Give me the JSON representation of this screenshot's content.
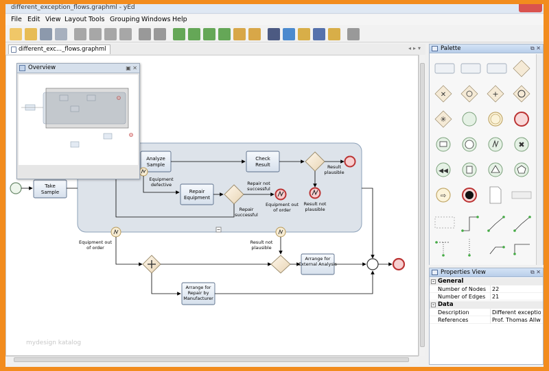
{
  "window": {
    "title": "different_exception_flows.graphml - yEd"
  },
  "menu": [
    "File",
    "Edit",
    "View",
    "Layout",
    "Tools",
    "Grouping",
    "Windows",
    "Help"
  ],
  "toolbar": [
    {
      "name": "new-document-icon",
      "color": "#f0c050"
    },
    {
      "name": "open-folder-icon",
      "color": "#e5b33a"
    },
    {
      "name": "save-icon",
      "color": "#7a8aa0"
    },
    {
      "name": "export-icon",
      "color": "#9aa5b5"
    },
    {
      "name": "cut-icon",
      "color": "#9a9a9a"
    },
    {
      "name": "copy-icon",
      "color": "#9a9a9a"
    },
    {
      "name": "paste-icon",
      "color": "#9a9a9a"
    },
    {
      "name": "delete-icon",
      "color": "#9a9a9a"
    },
    {
      "name": "undo-icon",
      "color": "#8a8a8a"
    },
    {
      "name": "redo-icon",
      "color": "#8a8a8a"
    },
    {
      "name": "zoom-in-icon",
      "color": "#4c9a3c"
    },
    {
      "name": "zoom-out-icon",
      "color": "#4c9a3c"
    },
    {
      "name": "zoom-original-icon",
      "color": "#4c9a3c"
    },
    {
      "name": "zoom-selection-icon",
      "color": "#4c9a3c"
    },
    {
      "name": "zoom-area-icon",
      "color": "#d39a2a"
    },
    {
      "name": "fit-content-icon",
      "color": "#d39a2a"
    },
    {
      "name": "select-mode-icon",
      "color": "#2f3f6f"
    },
    {
      "name": "snap-icon",
      "color": "#2f78c8"
    },
    {
      "name": "orthogonal-edges-icon",
      "color": "#d3a22a"
    },
    {
      "name": "grid-icon",
      "color": "#3a5aa0"
    },
    {
      "name": "port-icon",
      "color": "#d3a22a"
    },
    {
      "name": "layout-icon",
      "color": "#8a8a8a"
    }
  ],
  "document_tab": {
    "label": "different_exc..._flows.graphml"
  },
  "overview": {
    "title": "Overview"
  },
  "watermark": "mydesign katalog",
  "diagram": {
    "nodes": {
      "take_sample": "Take Sample",
      "analyze_sample": "Analyze Sample",
      "check_result": "Check Result",
      "repair_equipment": "Repair Equipment",
      "arrange_external": "Arrange for External Analysis",
      "arrange_repair": "Arrange for Repair by Manufacturer"
    },
    "labels": {
      "equipment_defective": "Equipment defective",
      "result_plausible_top": "Result plausible",
      "result_not_successful": "Repair not successful",
      "repair_successful": "Repair successful",
      "equipment_out_of_order_inner": "Equipment out of order",
      "result_not_plausible_inner": "Result not plausible",
      "equipment_out_of_order_outer": "Equipment out of order",
      "result_not_plausible_outer": "Result not plausible"
    }
  },
  "palette": {
    "title": "Palette"
  },
  "properties": {
    "title": "Properties View",
    "groups": [
      {
        "name": "General",
        "rows": [
          {
            "key": "Number of Nodes",
            "value": "22"
          },
          {
            "key": "Number of Edges",
            "value": "21"
          }
        ]
      },
      {
        "name": "Data",
        "rows": [
          {
            "key": "Description",
            "value": "Different exceptio..."
          },
          {
            "key": "References",
            "value": "Prof. Thomas Allwe..."
          }
        ]
      }
    ]
  }
}
